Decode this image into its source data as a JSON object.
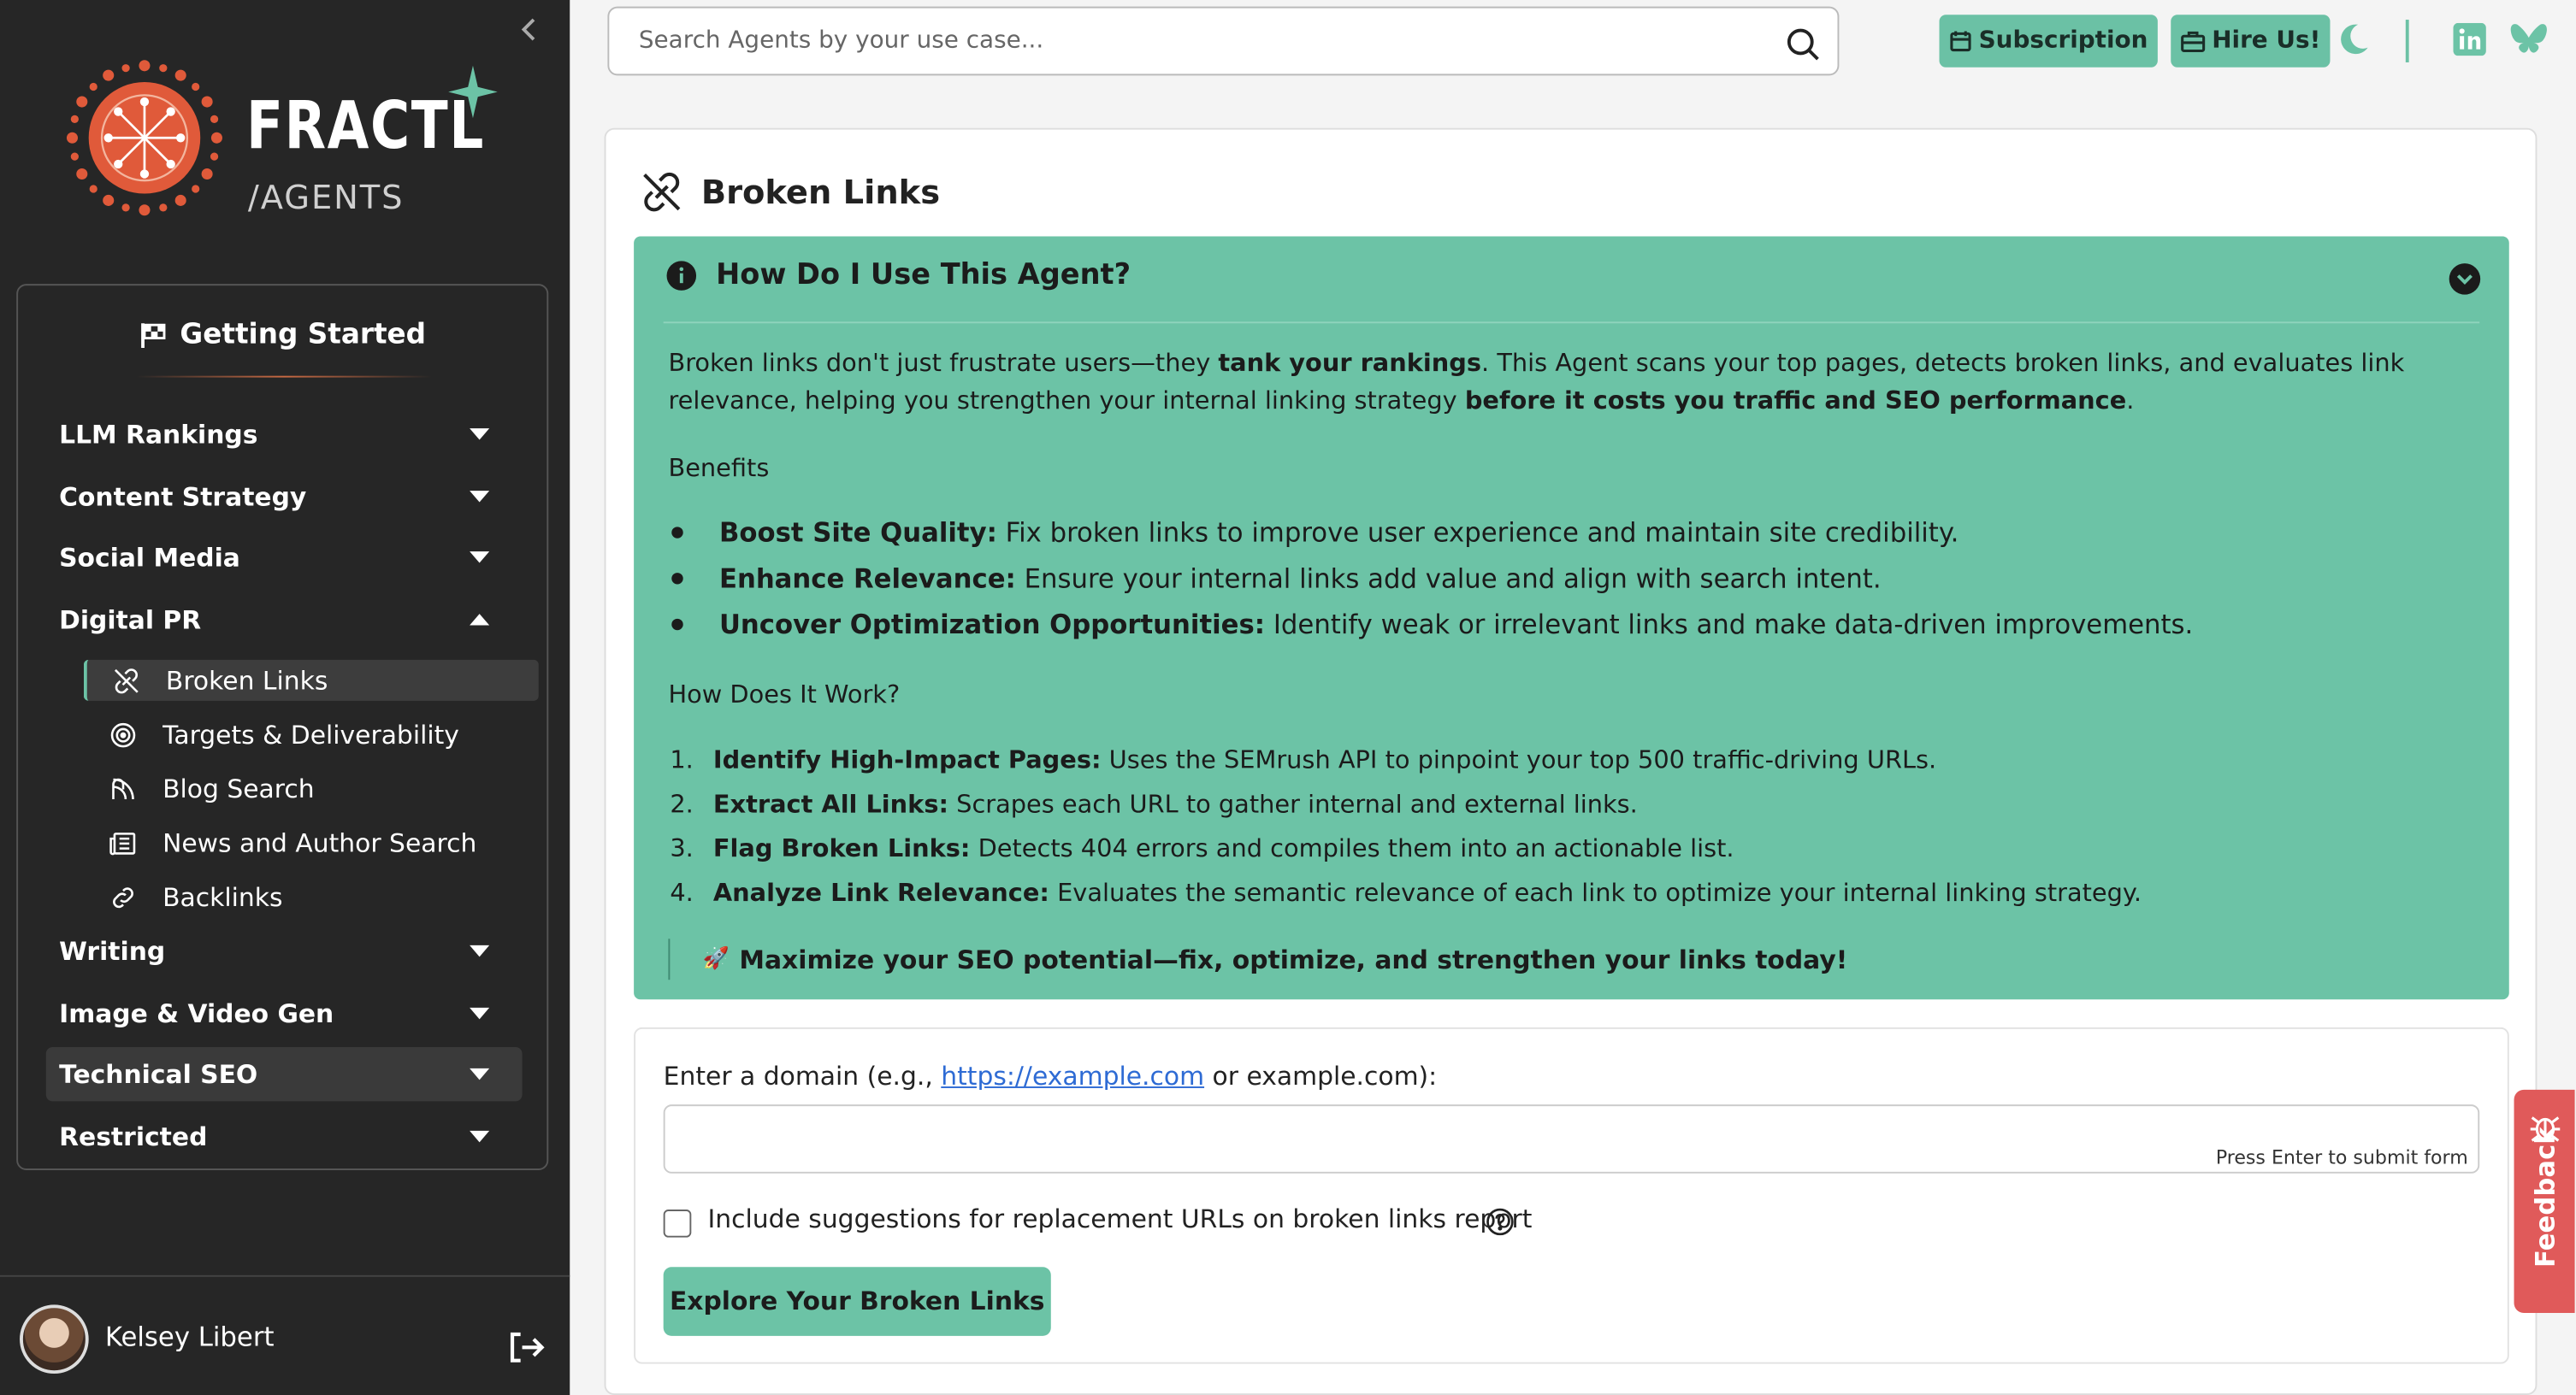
{
  "sidebar": {
    "logo": {
      "name": "FRACTL",
      "sub": "/AGENTS"
    },
    "getting_started": "Getting Started",
    "sections": [
      {
        "label": "LLM Rankings"
      },
      {
        "label": "Content Strategy"
      },
      {
        "label": "Social Media"
      },
      {
        "label": "Digital PR"
      },
      {
        "label": "Writing"
      },
      {
        "label": "Image & Video Gen"
      },
      {
        "label": "Technical SEO"
      },
      {
        "label": "Restricted"
      }
    ],
    "digital_pr_items": [
      {
        "label": "Broken Links",
        "icon": "broken-link-icon"
      },
      {
        "label": "Targets & Deliverability",
        "icon": "target-icon"
      },
      {
        "label": "Blog Search",
        "icon": "blog-icon"
      },
      {
        "label": "News and Author Search",
        "icon": "newspaper-icon"
      },
      {
        "label": "Backlinks",
        "icon": "link-icon"
      }
    ],
    "user": {
      "name": "Kelsey Libert"
    }
  },
  "topbar": {
    "search_placeholder": "Search Agents by your use case...",
    "subscription_label": "Subscription",
    "hire_label": "Hire Us!"
  },
  "page": {
    "title": "Broken Links",
    "howto": {
      "heading": "How Do I Use This Agent?",
      "intro_parts": [
        "Broken links don't just frustrate users—they ",
        "tank your rankings",
        ". This Agent scans your top pages, detects broken links, and evaluates link relevance, helping you strengthen your internal linking strategy ",
        "before it costs you traffic and SEO performance",
        "."
      ],
      "benefits_title": "Benefits",
      "benefits": [
        {
          "bold": "Boost Site Quality:",
          "text": " Fix broken links to improve user experience and maintain site credibility."
        },
        {
          "bold": "Enhance Relevance:",
          "text": " Ensure your internal links add value and align with search intent."
        },
        {
          "bold": "Uncover Optimization Opportunities:",
          "text": " Identify weak or irrelevant links and make data-driven improvements."
        }
      ],
      "how_title": "How Does It Work?",
      "steps": [
        {
          "n": "1.",
          "bold": "Identify High-Impact Pages:",
          "text": " Uses the SEMrush API to pinpoint your top 500 traffic-driving URLs."
        },
        {
          "n": "2.",
          "bold": "Extract All Links:",
          "text": " Scrapes each URL to gather internal and external links."
        },
        {
          "n": "3.",
          "bold": "Flag Broken Links:",
          "text": " Detects 404 errors and compiles them into an actionable list."
        },
        {
          "n": "4.",
          "bold": "Analyze Link Relevance:",
          "text": " Evaluates the semantic relevance of each link to optimize your internal linking strategy."
        }
      ],
      "quote_emoji": "🚀",
      "quote": "Maximize your SEO potential—fix, optimize, and strengthen your links today!"
    },
    "form": {
      "label_before": "Enter a domain (e.g., ",
      "label_link": "https://example.com",
      "label_after": " or example.com):",
      "domain_value": "",
      "enter_hint": "Press Enter to submit form",
      "checkbox_label": "Include suggestions for replacement URLs on broken links report",
      "submit_label": "Explore Your Broken Links"
    }
  },
  "feedback_label": "Feedback",
  "colors": {
    "accent": "#6cc3a6",
    "sidebar": "#262626",
    "feedback": "#e05a5a",
    "logo": "#e05a3a"
  }
}
